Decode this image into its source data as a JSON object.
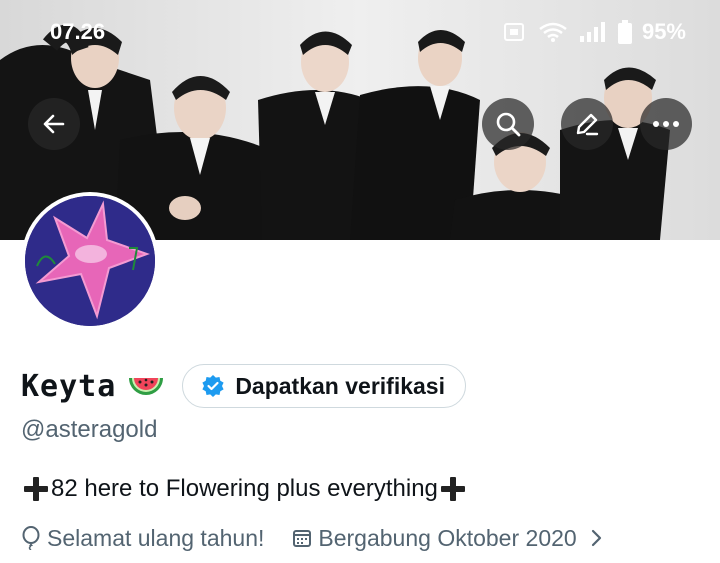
{
  "status_bar": {
    "time": "07.26",
    "battery": "95%"
  },
  "profile": {
    "display_name": "Keyta",
    "name_emoji": "watermelon",
    "verify_button_label": "Dapatkan verifikasi",
    "handle": "@asteragold",
    "bio": "82 here to Flowering plus everything",
    "birthday_text": "Selamat ulang tahun!",
    "joined_text": "Bergabung Oktober 2020"
  },
  "icons": {
    "back": "arrow-left-icon",
    "search": "search-icon",
    "edit": "pencil-icon",
    "more": "more-dots-icon",
    "verified": "verified-badge-icon",
    "balloon": "balloon-icon",
    "calendar": "calendar-icon"
  },
  "colors": {
    "accent": "#1d9bf0",
    "secondary_text": "#536471",
    "border": "#cfd9de"
  }
}
